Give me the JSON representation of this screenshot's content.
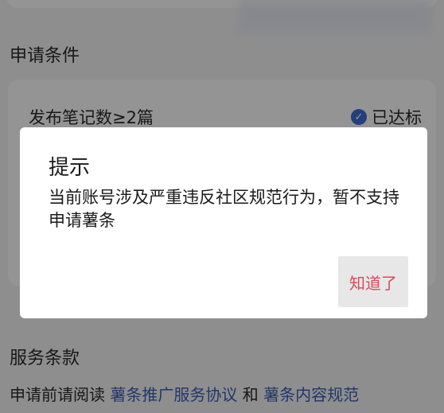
{
  "background": {
    "conditions_section_title": "申请条件",
    "condition": {
      "label": "发布笔记数≥2篇",
      "status": "已达标"
    },
    "terms_section_title": "服务条款",
    "terms": {
      "prefix": "申请前请阅读 ",
      "link1": "薯条推广服务协议",
      "connector": " 和 ",
      "link2": "薯条内容规范"
    }
  },
  "dialog": {
    "title": "提示",
    "message": "当前账号涉及严重违反社区规范行为，暂不支持申请薯条",
    "button_label": "知道了"
  },
  "colors": {
    "accent_link": "#3b5fb3",
    "button_text": "#d84a5e",
    "check_badge": "#3d6fd8"
  }
}
